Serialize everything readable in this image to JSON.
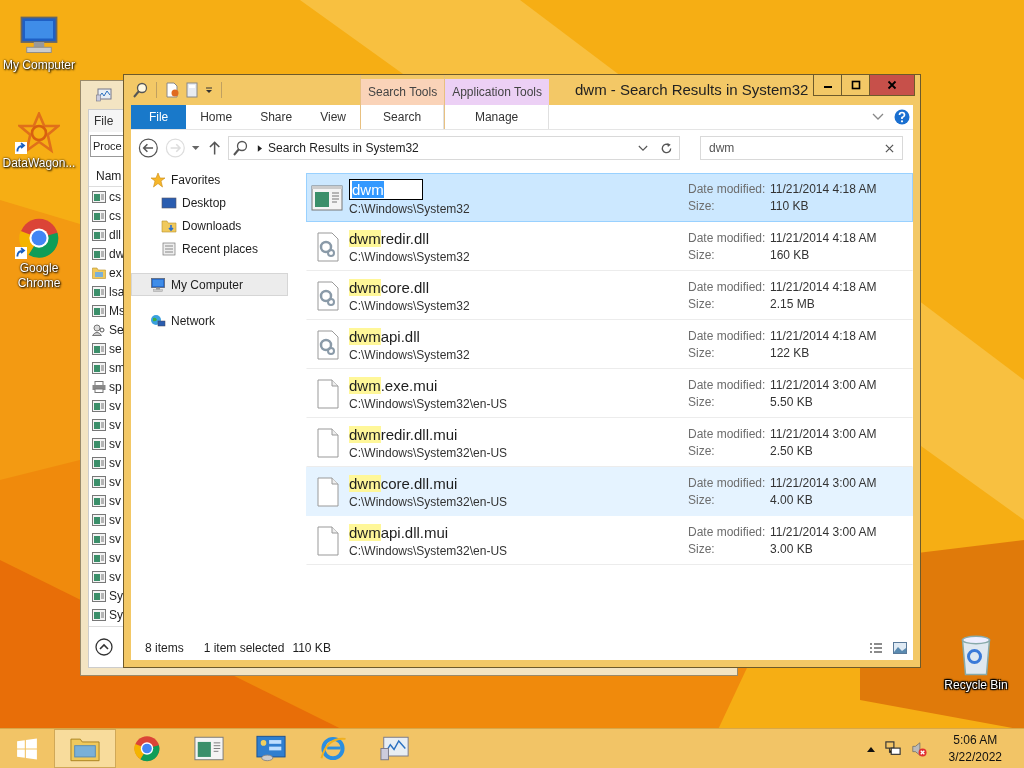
{
  "desktop_icons": [
    {
      "label": "My Computer",
      "kind": "computer",
      "shortcut": false
    },
    {
      "label": "DataWagon...",
      "kind": "emblem",
      "shortcut": true
    },
    {
      "label": "Google Chrome",
      "kind": "browser",
      "shortcut": true
    }
  ],
  "corner_icon": {
    "label": "Recycle Bin",
    "kind": "trash"
  },
  "back_window": {
    "menu": [
      "File"
    ],
    "dropdown": "Proce",
    "column_1": "Nam",
    "rows": [
      {
        "name": "cs",
        "kind": "app"
      },
      {
        "name": "cs",
        "kind": "app"
      },
      {
        "name": "dll",
        "kind": "app"
      },
      {
        "name": "dw",
        "kind": "app"
      },
      {
        "name": "ex",
        "kind": "folder"
      },
      {
        "name": "lsa",
        "kind": "app"
      },
      {
        "name": "Ms",
        "kind": "app"
      },
      {
        "name": "Se",
        "kind": "person"
      },
      {
        "name": "se",
        "kind": "app"
      },
      {
        "name": "sm",
        "kind": "app"
      },
      {
        "name": "sp",
        "kind": "printer"
      },
      {
        "name": "sv",
        "kind": "app"
      },
      {
        "name": "sv",
        "kind": "app"
      },
      {
        "name": "sv",
        "kind": "app"
      },
      {
        "name": "sv",
        "kind": "app"
      },
      {
        "name": "sv",
        "kind": "app"
      },
      {
        "name": "sv",
        "kind": "app"
      },
      {
        "name": "sv",
        "kind": "app"
      },
      {
        "name": "sv",
        "kind": "app"
      },
      {
        "name": "sv",
        "kind": "app"
      },
      {
        "name": "sv",
        "kind": "app"
      },
      {
        "name": "Sy",
        "kind": "app"
      },
      {
        "name": "Sy",
        "kind": "app"
      }
    ]
  },
  "explorer": {
    "title": "dwm - Search Results in System32",
    "ribbon_tabs": [
      {
        "label": "File",
        "kind": "file",
        "selected": false
      },
      {
        "label": "Home",
        "kind": "tab",
        "selected": false
      },
      {
        "label": "Share",
        "kind": "tab",
        "selected": false
      },
      {
        "label": "View",
        "kind": "tab",
        "selected": false
      }
    ],
    "context_groups": [
      {
        "label": "Search Tools",
        "color": "#fad3b8",
        "tabs": [
          {
            "label": "Search",
            "selected": false
          }
        ]
      },
      {
        "label": "Application Tools",
        "color": "#ecd0f5",
        "tabs": [
          {
            "label": "Manage",
            "selected": false
          }
        ]
      }
    ],
    "address": "Search Results in System32",
    "search": {
      "value": "dwm"
    },
    "nav": [
      {
        "label": "Favorites",
        "kind": "star",
        "selected": false,
        "children": [
          {
            "label": "Desktop",
            "kind": "desktop",
            "selected": false
          },
          {
            "label": "Downloads",
            "kind": "downloads",
            "selected": false
          },
          {
            "label": "Recent places",
            "kind": "recent",
            "selected": false
          }
        ]
      },
      {
        "label": "My Computer",
        "kind": "computer",
        "selected": true
      },
      {
        "label": "Network",
        "kind": "network",
        "selected": false
      }
    ],
    "files": [
      {
        "match": "dwm",
        "path": "C:\\Windows\\System32",
        "date_label": "Date modified:",
        "date": "11/21/2014 4:18 AM",
        "size_label": "Size:",
        "size": "110 KB",
        "kind": "app",
        "selected": true,
        "hovered": false,
        "renaming": true
      },
      {
        "match": "dwm",
        "rest": "redir.dll",
        "path": "C:\\Windows\\System32",
        "date_label": "Date modified:",
        "date": "11/21/2014 4:18 AM",
        "size_label": "Size:",
        "size": "160 KB",
        "kind": "dll",
        "selected": false,
        "hovered": false,
        "renaming": false
      },
      {
        "match": "dwm",
        "rest": "core.dll",
        "path": "C:\\Windows\\System32",
        "date_label": "Date modified:",
        "date": "11/21/2014 4:18 AM",
        "size_label": "Size:",
        "size": "2.15 MB",
        "kind": "dll",
        "selected": false,
        "hovered": false,
        "renaming": false
      },
      {
        "match": "dwm",
        "rest": "api.dll",
        "path": "C:\\Windows\\System32",
        "date_label": "Date modified:",
        "date": "11/21/2014 4:18 AM",
        "size_label": "Size:",
        "size": "122 KB",
        "kind": "dll",
        "selected": false,
        "hovered": false,
        "renaming": false
      },
      {
        "match": "dwm",
        "rest": ".exe.mui",
        "path": "C:\\Windows\\System32\\en-US",
        "date_label": "Date modified:",
        "date": "11/21/2014 3:00 AM",
        "size_label": "Size:",
        "size": "5.50 KB",
        "kind": "file",
        "selected": false,
        "hovered": false,
        "renaming": false
      },
      {
        "match": "dwm",
        "rest": "redir.dll.mui",
        "path": "C:\\Windows\\System32\\en-US",
        "date_label": "Date modified:",
        "date": "11/21/2014 3:00 AM",
        "size_label": "Size:",
        "size": "2.50 KB",
        "kind": "file",
        "selected": false,
        "hovered": false,
        "renaming": false
      },
      {
        "match": "dwm",
        "rest": "core.dll.mui",
        "path": "C:\\Windows\\System32\\en-US",
        "date_label": "Date modified:",
        "date": "11/21/2014 3:00 AM",
        "size_label": "Size:",
        "size": "4.00 KB",
        "kind": "file",
        "selected": false,
        "hovered": true,
        "renaming": false
      },
      {
        "match": "dwm",
        "rest": "api.dll.mui",
        "path": "C:\\Windows\\System32\\en-US",
        "date_label": "Date modified:",
        "date": "11/21/2014 3:00 AM",
        "size_label": "Size:",
        "size": "3.00 KB",
        "kind": "file",
        "selected": false,
        "hovered": false,
        "renaming": false
      }
    ],
    "status": {
      "count": "8 items",
      "selection": "1 item selected",
      "size": "110 KB"
    }
  },
  "taskbar": {
    "items": [
      {
        "kind": "folder",
        "active": true
      },
      {
        "kind": "browser",
        "active": false
      },
      {
        "kind": "app",
        "active": false
      },
      {
        "kind": "panel",
        "active": false
      },
      {
        "kind": "globe",
        "active": false
      },
      {
        "kind": "monitor",
        "active": false
      }
    ],
    "clock": {
      "time": "5:06 AM",
      "date": "3/22/2022"
    }
  }
}
